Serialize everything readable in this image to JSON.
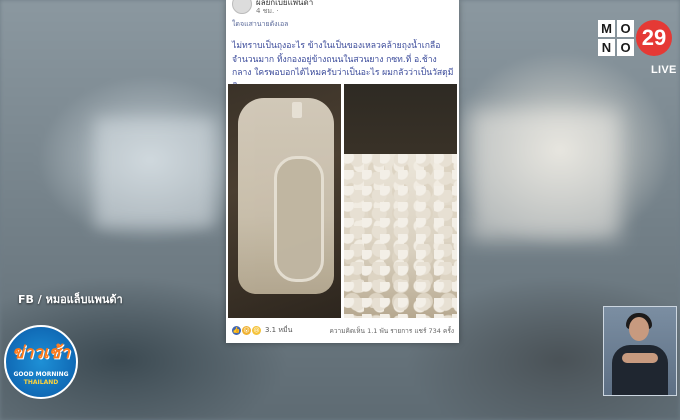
{
  "post": {
    "author": "ผลยกเบยแพนดา",
    "meta": "4 ชม. · ",
    "translate": "ใดจแสานายดังเอล",
    "text": "ไม่ทราบเป็นถุงอะไร ข้างในเป็นของเหลวคล้ายถุงน้ำเกลือ จำนวนมาก ทิ้งกองอยู่ข้างถนนในสวนยาง กซท.ที่ อ.ช้างกลาง ใครพอบอกได้ไหมครับว่าเป็นอะไร ผมกลัวว่าเป็นวัสดุมีพิษ",
    "reactions_count": "3.1 หมื่น",
    "stats": "ความคิดเห็น 1.1 พัน รายการ  แชร์ 734 ครั้ง"
  },
  "channel": {
    "logo_letters": [
      "M",
      "O",
      "N",
      "O"
    ],
    "logo_number": "29",
    "live_label": "LIVE"
  },
  "source_caption": "FB / หมอแล็บแพนด้า",
  "show_badge": {
    "title": "ข่าวเช้า",
    "subtitle1": "GOOD MORNING",
    "subtitle2": "THAILAND"
  }
}
